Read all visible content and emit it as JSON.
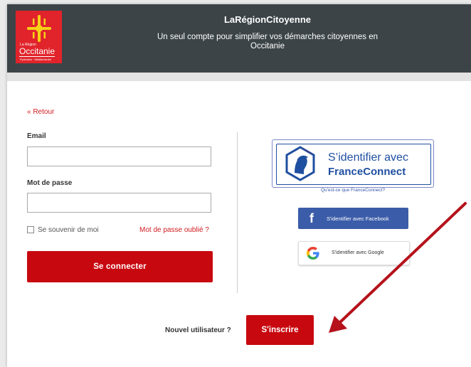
{
  "header": {
    "logo_small": "La Région",
    "logo_name": "Occitanie",
    "logo_tagline": "Pyrénées · Méditerranée",
    "title": "LaRégionCitoyenne",
    "subtitle_line1": "Un seul compte pour simplifier vos démarches citoyennes en",
    "subtitle_line2": "Occitanie"
  },
  "login": {
    "back_link": "« Retour",
    "email_label": "Email",
    "email_value": "",
    "password_label": "Mot de passe",
    "password_value": "",
    "remember_label": "Se souvenir de moi",
    "forgot_link": "Mot de passe oublié ?",
    "submit_label": "Se connecter"
  },
  "social": {
    "franceconnect_line1": "S’identifier avec",
    "franceconnect_line2": "FranceConnect",
    "franceconnect_help": "Qu'est-ce que FranceConnect?",
    "facebook_label": "S'identifier avec Facebook",
    "google_label": "S'identifier avec Google"
  },
  "signup": {
    "prompt": "Nouvel utilisateur ?",
    "button_label": "S'inscrire"
  },
  "colors": {
    "header_bg": "#3c4448",
    "brand_red": "#c8080f",
    "facebook_blue": "#3b5ca8",
    "franceconnect_blue": "#1f4fa0"
  },
  "icons": {
    "region_logo": "occitanie-cross-icon",
    "franceconnect": "marianne-icon",
    "facebook": "facebook-f-icon",
    "google": "google-g-icon",
    "annotation": "red-arrow-icon"
  }
}
